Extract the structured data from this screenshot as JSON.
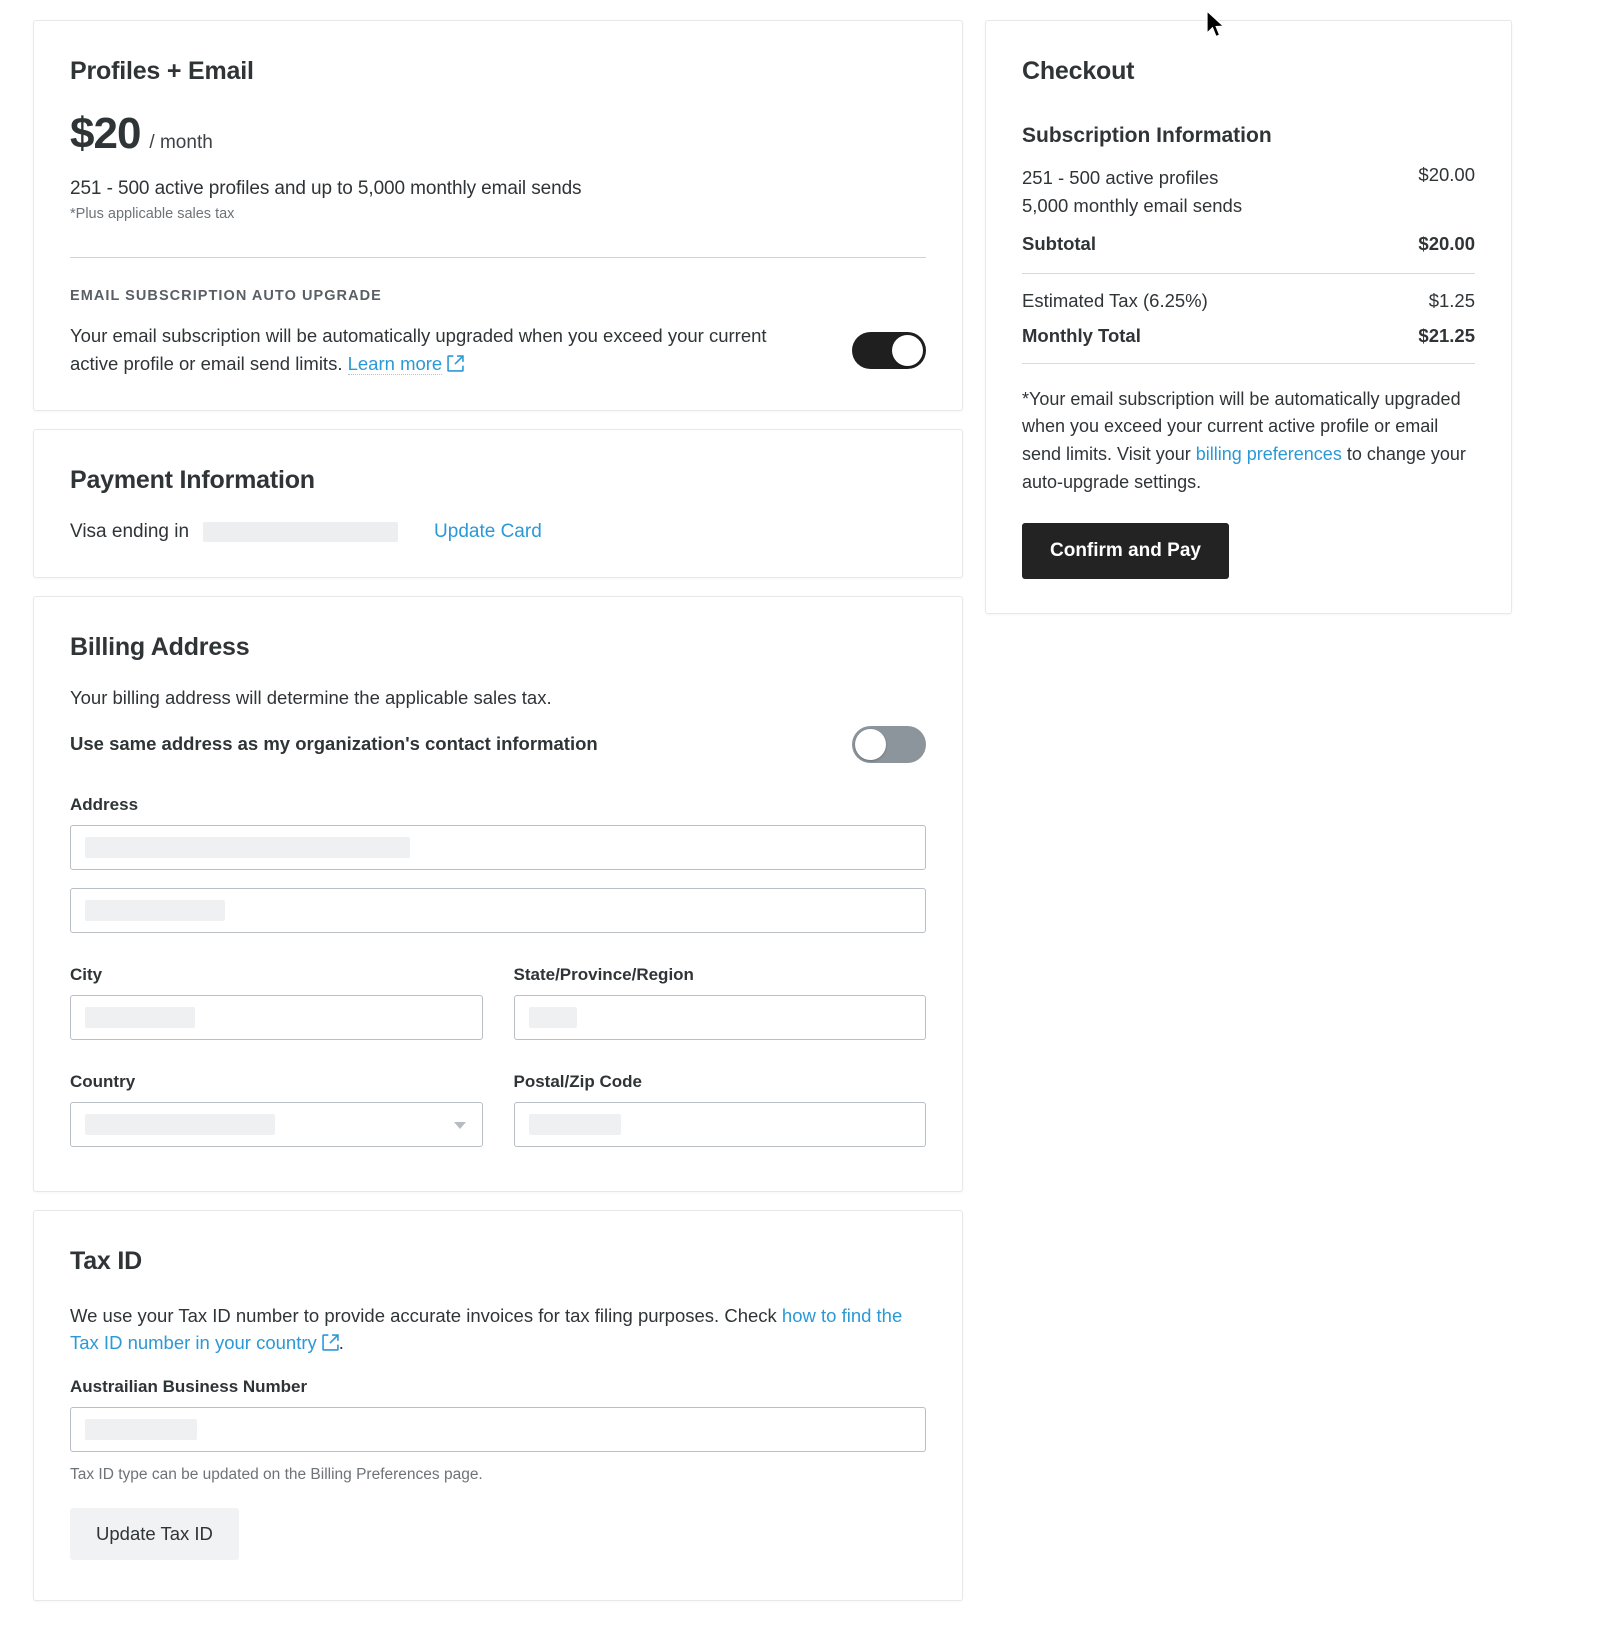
{
  "plan": {
    "title": "Profiles + Email",
    "price_amount": "$20",
    "price_period": "/ month",
    "description": "251 - 500 active profiles and up to 5,000 monthly email sends",
    "tax_note": "*Plus applicable sales tax",
    "auto_upgrade_heading": "EMAIL SUBSCRIPTION AUTO UPGRADE",
    "auto_upgrade_text": "Your email subscription will be automatically upgraded when you exceed your current active profile or email send limits.",
    "learn_more_label": "Learn more",
    "toggle_state": "on"
  },
  "payment": {
    "title": "Payment Information",
    "card_text": "Visa ending in",
    "card_digits_redacted": "",
    "update_card_label": "Update Card"
  },
  "billing": {
    "title": "Billing Address",
    "description": "Your billing address will determine the applicable sales tax.",
    "same_address_label": "Use same address as my organization's contact information",
    "toggle_state": "off",
    "address_label": "Address",
    "address_line1_value": "",
    "address_line2_value": "",
    "city_label": "City",
    "city_value": "",
    "state_label": "State/Province/Region",
    "state_value": "",
    "country_label": "Country",
    "country_value": "",
    "postal_label": "Postal/Zip Code",
    "postal_value": ""
  },
  "tax": {
    "title": "Tax ID",
    "description_part1": "We use your Tax ID number to provide accurate invoices for tax filing purposes. Check ",
    "link_label": "how to find the Tax ID number in your country",
    "description_part2": ".",
    "field_label": "Austrailian Business Number",
    "field_value": "",
    "helper_text": "Tax ID type can be updated on the Billing Preferences page.",
    "update_button_label": "Update Tax ID"
  },
  "checkout": {
    "title": "Checkout",
    "subscription_heading": "Subscription Information",
    "items": [
      {
        "desc_line1": "251 - 500 active profiles",
        "desc_line2": "5,000 monthly email sends",
        "amount": "$20.00"
      }
    ],
    "subtotal_label": "Subtotal",
    "subtotal_amount": "$20.00",
    "tax_label": "Estimated Tax (6.25%)",
    "tax_amount": "$1.25",
    "total_label": "Monthly Total",
    "total_amount": "$21.25",
    "note_part1": "*Your email subscription will be automatically upgraded when you exceed your current active profile or email send limits. Visit your ",
    "note_link": "billing preferences",
    "note_part2": " to change your auto-upgrade settings.",
    "confirm_button_label": "Confirm and Pay"
  },
  "colors": {
    "link": "#2b99d6",
    "toggle_on": "#1f1f1f",
    "toggle_off": "#8d959c",
    "primary_button": "#232323"
  }
}
